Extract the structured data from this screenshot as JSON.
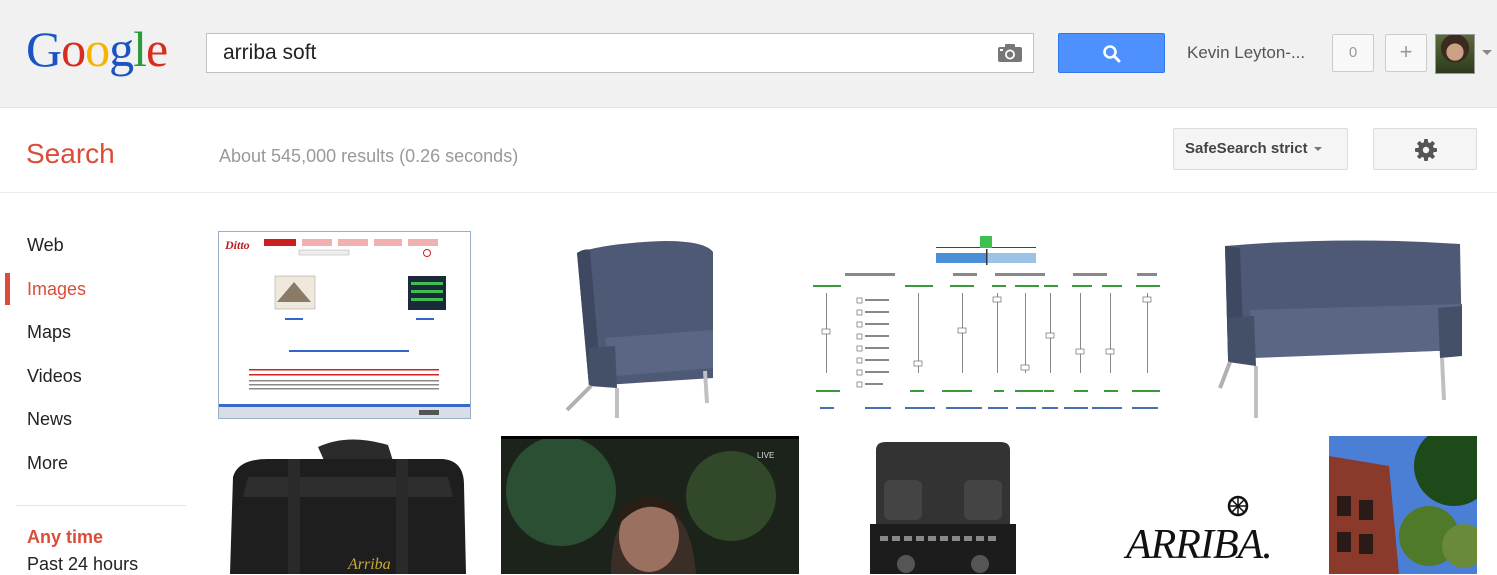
{
  "header": {
    "logo_letters": [
      "G",
      "o",
      "o",
      "g",
      "l",
      "e"
    ],
    "logo_colors": [
      "#1a54c4",
      "#d62d20",
      "#f5b400",
      "#1a54c4",
      "#2a9b3b",
      "#d62d20"
    ],
    "query": "arriba soft",
    "camera_icon": "camera-icon",
    "search_icon": "magnifier-icon",
    "user_name": "Kevin Leyton-...",
    "notification_count": "0",
    "share_label": "+"
  },
  "toolbar": {
    "section_title": "Search",
    "result_stats": "About 545,000 results (0.26 seconds)",
    "safesearch_label": "SafeSearch strict",
    "settings_icon": "gear-icon"
  },
  "sidebar": {
    "items": [
      {
        "label": "Web",
        "active": false
      },
      {
        "label": "Images",
        "active": true
      },
      {
        "label": "Maps",
        "active": false
      },
      {
        "label": "Videos",
        "active": false
      },
      {
        "label": "News",
        "active": false
      },
      {
        "label": "More",
        "active": false
      }
    ],
    "time_filter_active": "Any time",
    "time_filter_next": "Past 24 hours"
  },
  "results": {
    "arriba_logo_text": "ARRIBA."
  },
  "colors": {
    "accent_red": "#dd4b39",
    "search_blue": "#4d90fe",
    "chair_blue": "#4e5a75"
  }
}
